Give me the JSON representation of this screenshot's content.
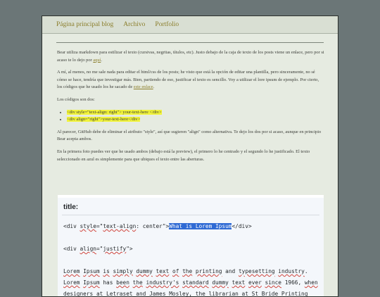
{
  "nav": {
    "home": "Página principal blog",
    "archive": "Archivo",
    "portfolio": "Portfolio"
  },
  "content": {
    "p1_text": "Bear utiliza markdown para estilizar el texto (cursivas, negritas, títulos, etc). Justo debajo de la caja de texto de los posts viene un enlace, pero por si acaso te lo dejo por ",
    "p1_link": "aquí",
    "p1_end": ".",
    "p2_text": "A mí, al menos, no me sale nada para editar el html/css de los posts; he visto que está la opción de editar una plantilla, pero sinceramente, no sé cómo se hace, tendría que investigar más. Bien, partiendo de eso, justificar el texto es sencillo. Voy a utilizar el lore ipsum de ejemplo. Por cierto, los códigos que he usado los he sacado de ",
    "p2_link": "este enlace",
    "p2_end": ".",
    "p3_text": "Los códigos son dos:",
    "list": [
      "<div style=\"text-align: right\"> your-text-here </div>",
      "<div align=\"right\">your-text-here</div>"
    ],
    "p4_text": "Al parecer, GitHub debe de eliminar el atributo \"style\", así que sugieren \"align\" como alternativa. Te dejo los dos por si acaso, aunque en principio Bear acepta ambos.",
    "p5_text": "En la primera foto puedes ver que he usado ambos (debajo está la preview), el primero lo he centrado y el segundo lo he justificado. El texto seleccionado en azul es simplemente para que ubiques el texto entre las aberturas."
  },
  "code": {
    "title": "title:",
    "l1_a": "<div ",
    "l1_style": "style",
    "l1_b": "=\"",
    "l1_ta": "text-align",
    "l1_c": ": center\">",
    "l1_sel": "What is Lorem Ipsum",
    "l1_d": "</div>",
    "l2_a": "<div ",
    "l2_align": "align",
    "l2_b": "=\"",
    "l2_j": "justify",
    "l2_c": "\">",
    "l3": [
      "Lorem",
      " ",
      "Ipsum",
      " ",
      "is",
      " ",
      "simply",
      " ",
      "dummy",
      " ",
      "text",
      " ",
      "of",
      " ",
      "the",
      " ",
      "printing",
      " and ",
      "typesetting",
      " ",
      "industry",
      "."
    ],
    "l4": [
      "Lorem",
      " ",
      "Ipsum",
      " has ",
      "been",
      " ",
      "the",
      " ",
      "industry's",
      " ",
      "standard",
      " ",
      "dummy",
      " ",
      "text",
      " ",
      "ever",
      " ",
      "since",
      " 1966, ",
      "when"
    ],
    "l5": [
      "designers",
      " at ",
      "Letraset",
      " and James Mosley, ",
      "the",
      " ",
      "librarian",
      " at ",
      "St",
      " Bride ",
      "Printing"
    ]
  }
}
